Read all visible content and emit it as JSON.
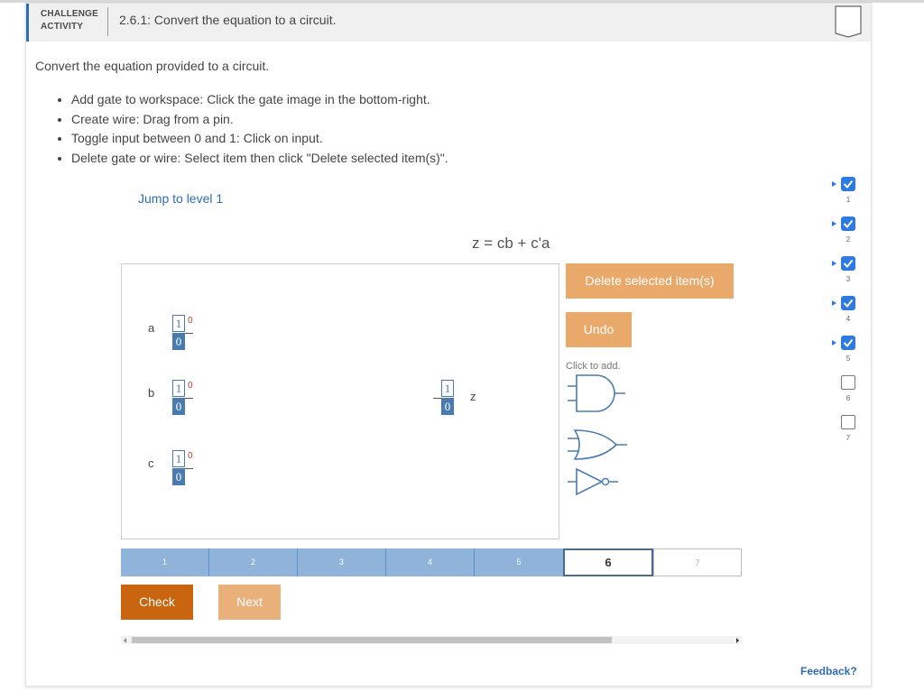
{
  "header": {
    "label_line1": "CHALLENGE",
    "label_line2": "ACTIVITY",
    "title": "2.6.1: Convert the equation to a circuit."
  },
  "intro": "Convert the equation provided to a circuit.",
  "instructions": [
    "Add gate to workspace: Click the gate image in the bottom-right.",
    "Create wire: Drag from a pin.",
    "Toggle input between 0 and 1: Click on input.",
    "Delete gate or wire: Select item then click \"Delete selected item(s)\"."
  ],
  "jump_link": "Jump to level 1",
  "equation": "z = cb + c'a",
  "workspace": {
    "inputs": [
      {
        "name": "a",
        "top": "1",
        "bottom": "0",
        "alt": "0"
      },
      {
        "name": "b",
        "top": "1",
        "bottom": "0",
        "alt": "0"
      },
      {
        "name": "c",
        "top": "1",
        "bottom": "0",
        "alt": "0"
      }
    ],
    "output": {
      "name": "z",
      "top": "1",
      "bottom": "0"
    }
  },
  "buttons": {
    "delete": "Delete selected item(s)",
    "undo": "Undo",
    "check": "Check",
    "next": "Next"
  },
  "click_to_add": "Click to add.",
  "gates": [
    "and-gate-icon",
    "or-gate-icon",
    "not-gate-icon"
  ],
  "progress": {
    "levels": [
      "1",
      "2",
      "3",
      "4",
      "5",
      "6",
      "7"
    ],
    "completed": 5,
    "current": "6"
  },
  "side_levels": [
    "1",
    "2",
    "3",
    "4",
    "5",
    "6",
    "7"
  ],
  "feedback": "Feedback?",
  "colors": {
    "accent": "#2d6db5",
    "orange": "#c8650e",
    "orange_light": "#e8a96b",
    "progress_done": "#8fb3d9"
  }
}
